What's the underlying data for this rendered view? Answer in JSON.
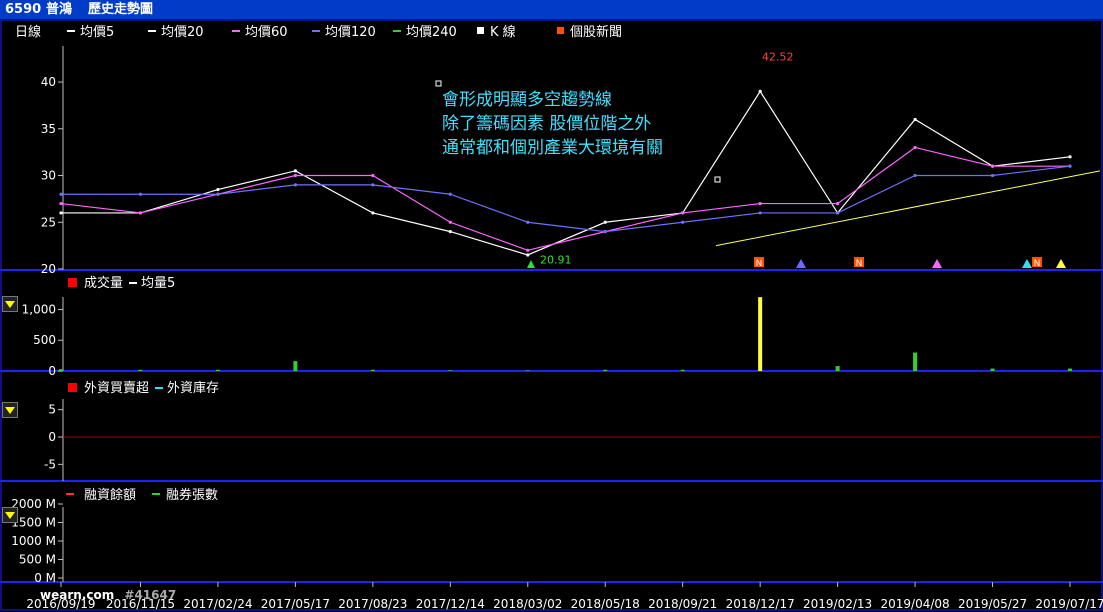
{
  "header": {
    "code": "6590",
    "name": "普鴻",
    "title": "歷史走勢圖"
  },
  "colors": {
    "title_bg": "#003cc8",
    "divider": "#2020ff",
    "axis": "#c0c0c0",
    "ma5": "#ffffff",
    "ma20": "#ffffff",
    "ma60": "#ff66ff",
    "ma120": "#7070ff",
    "ma240": "#33cc33",
    "up": "#ff3030",
    "down": "#30d030",
    "fi_stock": "#30e0ff",
    "trend": "#ffff66"
  },
  "price_legend": {
    "period": "日線",
    "items": [
      "均價5",
      "均價20",
      "均價60",
      "均價120",
      "均價240",
      "K 線",
      "個股新聞"
    ]
  },
  "annotation": {
    "lines": [
      "會形成明顯多空趨勢線",
      "除了籌碼因素 股價位階之外",
      "通常都和個別產業大環境有關"
    ],
    "high_label": "42.52",
    "low_label": "20.91"
  },
  "volume_legend": {
    "items": [
      "成交量",
      "均量5"
    ]
  },
  "foreign_legend": {
    "items": [
      "外資買賣超",
      "外資庫存"
    ]
  },
  "margin_legend": {
    "items": [
      "融資餘額",
      "融券張數"
    ]
  },
  "x_labels": [
    "2016/09/19",
    "2016/11/15",
    "2017/02/24",
    "2017/05/17",
    "2017/08/23",
    "2017/12/14",
    "2018/03/02",
    "2018/05/18",
    "2018/09/21",
    "2018/12/17",
    "2019/02/13",
    "2019/04/08",
    "2019/05/27",
    "2019/07/17"
  ],
  "footer": {
    "mark": "wearn.com",
    "counter": "#41647"
  },
  "chart_data": [
    {
      "type": "line",
      "panel": "price",
      "x": [
        "2016/09/19",
        "2016/11/15",
        "2017/02/24",
        "2017/05/17",
        "2017/08/23",
        "2017/12/14",
        "2018/03/02",
        "2018/05/18",
        "2018/09/21",
        "2018/12/17",
        "2019/02/13",
        "2019/04/08",
        "2019/05/27",
        "2019/07/17"
      ],
      "ylim": [
        20,
        43
      ],
      "yticks": [
        20,
        25,
        30,
        35,
        40
      ],
      "series": [
        {
          "name": "K 線",
          "values": [
            26,
            26,
            28.5,
            30.5,
            26,
            24,
            21.5,
            25,
            26,
            39,
            26,
            36,
            31,
            32
          ]
        },
        {
          "name": "均價60",
          "values": [
            27,
            26,
            28,
            30,
            30,
            25,
            22,
            24,
            26,
            27,
            27,
            33,
            31,
            31
          ]
        },
        {
          "name": "均價120",
          "values": [
            28,
            28,
            28,
            29,
            29,
            28,
            25,
            24,
            25,
            26,
            26,
            30,
            30,
            31
          ]
        }
      ]
    },
    {
      "type": "bar",
      "panel": "volume",
      "ylim": [
        0,
        1300
      ],
      "yticks": [
        0,
        500,
        1000
      ],
      "ytick_labels": [
        "0",
        "500",
        "1,000"
      ],
      "x": [
        "2016/09/19",
        "2016/11/15",
        "2017/02/24",
        "2017/05/17",
        "2017/08/23",
        "2017/12/14",
        "2018/03/02",
        "2018/05/18",
        "2018/09/21",
        "2018/12/17",
        "2019/02/13",
        "2019/04/08",
        "2019/05/27",
        "2019/07/17"
      ],
      "series": [
        {
          "name": "成交量",
          "values": [
            30,
            20,
            20,
            160,
            20,
            10,
            10,
            20,
            20,
            1200,
            80,
            300,
            40,
            40
          ]
        }
      ]
    },
    {
      "type": "bar",
      "panel": "foreign",
      "ylim": [
        -7.5,
        7.5
      ],
      "yticks": [
        -5,
        0,
        5
      ]
    },
    {
      "type": "line",
      "panel": "margin",
      "yticks": [
        "0 M",
        "500 M",
        "1000 M",
        "1500 M",
        "2000 M"
      ]
    }
  ]
}
